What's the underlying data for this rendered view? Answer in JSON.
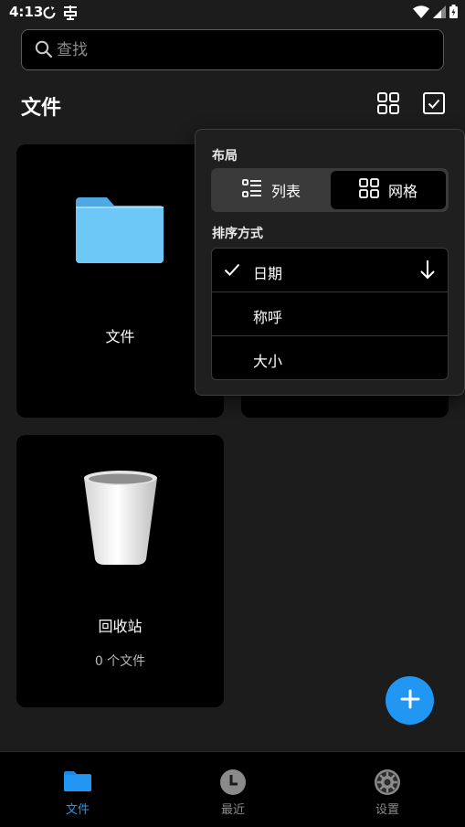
{
  "status_bar": {
    "time": "4:13",
    "icons": [
      "sync-icon",
      "notification-icon",
      "wifi-icon",
      "signal-icon",
      "battery-icon"
    ]
  },
  "search": {
    "placeholder": "查找",
    "value": ""
  },
  "header": {
    "title": "文件",
    "icons": [
      "grid-view-icon",
      "select-checkbox-icon"
    ]
  },
  "cards": [
    {
      "name": "文件",
      "icon": "folder-icon"
    },
    {
      "name": "",
      "icon": ""
    },
    {
      "name": "回收站",
      "subtitle": "0 个文件",
      "icon": "trash-icon"
    }
  ],
  "popup": {
    "layout_label": "布局",
    "layout_options": [
      {
        "label": "列表",
        "icon": "list-icon",
        "selected": false
      },
      {
        "label": "网格",
        "icon": "grid-icon",
        "selected": true
      }
    ],
    "sort_label": "排序方式",
    "sort_options": [
      {
        "label": "日期",
        "checked": true,
        "direction": "descending"
      },
      {
        "label": "称呼",
        "checked": false
      },
      {
        "label": "大小",
        "checked": false
      }
    ]
  },
  "fab": {
    "icon": "plus-icon"
  },
  "bottom_nav": [
    {
      "label": "文件",
      "icon": "folder-icon",
      "active": true
    },
    {
      "label": "最近",
      "icon": "clock-icon",
      "active": false
    },
    {
      "label": "设置",
      "icon": "gear-icon",
      "active": false
    }
  ],
  "colors": {
    "accent": "#2196f3",
    "background": "#1c1c1c",
    "card": "#000000",
    "folder": "#64c4f5"
  }
}
